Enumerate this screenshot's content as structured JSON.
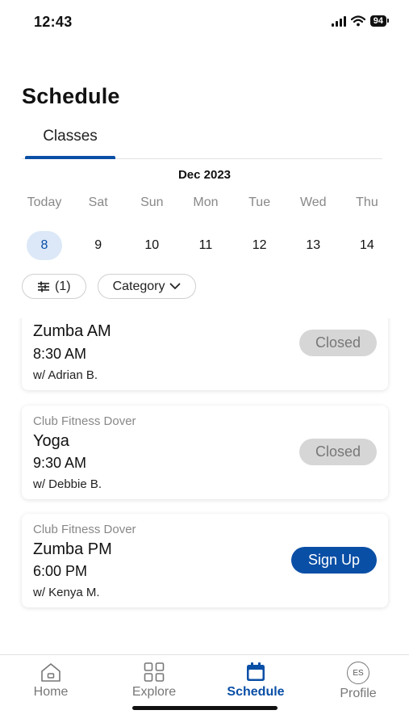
{
  "status_bar": {
    "time": "12:43",
    "battery": "94"
  },
  "header": {
    "title": "Schedule"
  },
  "tabs": [
    {
      "label": "Classes"
    }
  ],
  "calendar": {
    "month": "Dec 2023",
    "days": [
      {
        "name": "Today",
        "num": "8",
        "selected": true
      },
      {
        "name": "Sat",
        "num": "9"
      },
      {
        "name": "Sun",
        "num": "10"
      },
      {
        "name": "Mon",
        "num": "11"
      },
      {
        "name": "Tue",
        "num": "12"
      },
      {
        "name": "Wed",
        "num": "13"
      },
      {
        "name": "Thu",
        "num": "14"
      }
    ]
  },
  "filters": {
    "filter_count": "(1)",
    "category_label": "Category"
  },
  "classes": [
    {
      "club": "",
      "name": "Zumba AM",
      "time": "8:30 AM",
      "instructor": "w/ Adrian B.",
      "status": "Closed"
    },
    {
      "club": "Club Fitness Dover",
      "name": "Yoga",
      "time": "9:30 AM",
      "instructor": "w/ Debbie B.",
      "status": "Closed"
    },
    {
      "club": "Club Fitness Dover",
      "name": "Zumba PM",
      "time": "6:00 PM",
      "instructor": "w/ Kenya M.",
      "status": "Sign Up"
    }
  ],
  "nav": {
    "home": "Home",
    "explore": "Explore",
    "schedule": "Schedule",
    "profile": "Profile",
    "profile_initials": "ES"
  },
  "colors": {
    "accent": "#0a4fa6",
    "selected_day_bg": "#dce8f7",
    "closed_bg": "#d6d6d6"
  },
  "icons": {
    "signal": "signal-icon",
    "wifi": "wifi-icon",
    "filter": "sliders-icon",
    "chevron": "chevron-down-icon",
    "home": "home-icon",
    "explore": "grid-icon",
    "schedule": "calendar-icon"
  }
}
